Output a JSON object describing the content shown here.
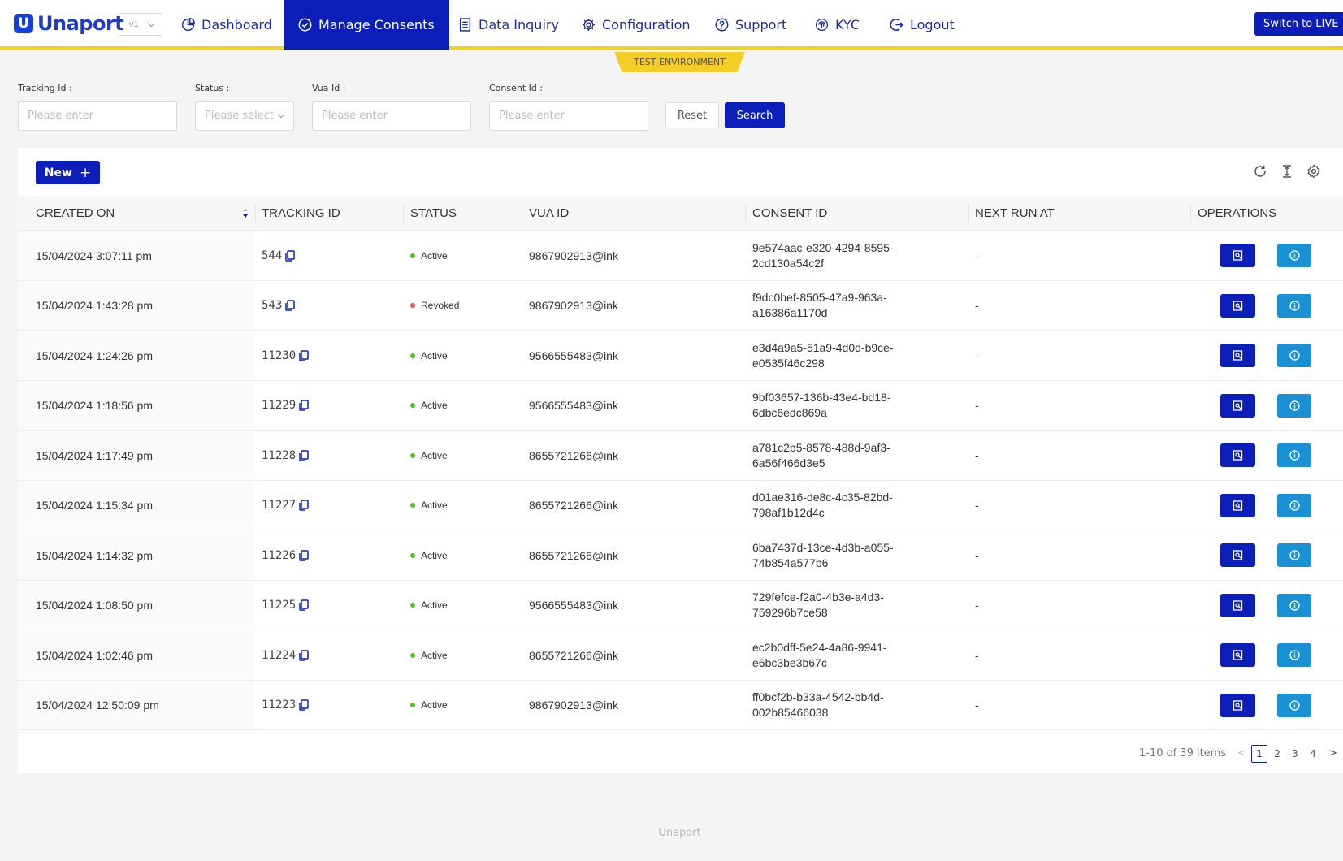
{
  "app": {
    "logo_letter": "U",
    "logo_text": "Unaport",
    "version": "v1",
    "env_label": "TEST ENVIRONMENT",
    "switch_label": "Switch to LIVE",
    "footer": "Unaport"
  },
  "nav": {
    "dashboard": "Dashboard",
    "manage_consents": "Manage Consents",
    "data_inquiry": "Data Inquiry",
    "configuration": "Configuration",
    "support": "Support",
    "kyc": "KYC",
    "logout": "Logout"
  },
  "filters": {
    "tracking_label": "Tracking Id :",
    "tracking_placeholder": "Please enter",
    "status_label": "Status :",
    "status_placeholder": "Please select",
    "vua_label": "Vua Id :",
    "vua_placeholder": "Please enter",
    "consent_label": "Consent Id :",
    "consent_placeholder": "Please enter",
    "reset": "Reset",
    "search": "Search"
  },
  "toolbar": {
    "new_label": "New",
    "new_icon": "+"
  },
  "table": {
    "headers": {
      "created_on": "CREATED ON",
      "tracking_id": "TRACKING ID",
      "status": "STATUS",
      "vua_id": "VUA ID",
      "consent_id": "CONSENT ID",
      "next_run_at": "NEXT RUN AT",
      "operations": "OPERATIONS"
    },
    "rows": [
      {
        "created": "15/04/2024 3:07:11 pm",
        "tracking": "544",
        "status": "Active",
        "vua": "9867902913@ink",
        "consent1": "9e574aac-e320-4294-8595-",
        "consent2": "2cd130a54c2f",
        "next": "-"
      },
      {
        "created": "15/04/2024 1:43:28 pm",
        "tracking": "543",
        "status": "Revoked",
        "vua": "9867902913@ink",
        "consent1": "f9dc0bef-8505-47a9-963a-",
        "consent2": "a16386a1170d",
        "next": "-"
      },
      {
        "created": "15/04/2024 1:24:26 pm",
        "tracking": "11230",
        "status": "Active",
        "vua": "9566555483@ink",
        "consent1": "e3d4a9a5-51a9-4d0d-b9ce-",
        "consent2": "e0535f46c298",
        "next": "-"
      },
      {
        "created": "15/04/2024 1:18:56 pm",
        "tracking": "11229",
        "status": "Active",
        "vua": "9566555483@ink",
        "consent1": "9bf03657-136b-43e4-bd18-",
        "consent2": "6dbc6edc869a",
        "next": "-"
      },
      {
        "created": "15/04/2024 1:17:49 pm",
        "tracking": "11228",
        "status": "Active",
        "vua": "8655721266@ink",
        "consent1": "a781c2b5-8578-488d-9af3-",
        "consent2": "6a56f466d3e5",
        "next": "-"
      },
      {
        "created": "15/04/2024 1:15:34 pm",
        "tracking": "11227",
        "status": "Active",
        "vua": "8655721266@ink",
        "consent1": "d01ae316-de8c-4c35-82bd-",
        "consent2": "798af1b12d4c",
        "next": "-"
      },
      {
        "created": "15/04/2024 1:14:32 pm",
        "tracking": "11226",
        "status": "Active",
        "vua": "8655721266@ink",
        "consent1": "6ba7437d-13ce-4d3b-a055-",
        "consent2": "74b854a577b6",
        "next": "-"
      },
      {
        "created": "15/04/2024 1:08:50 pm",
        "tracking": "11225",
        "status": "Active",
        "vua": "9566555483@ink",
        "consent1": "729fefce-f2a0-4b3e-a4d3-",
        "consent2": "759296b7ce58",
        "next": "-"
      },
      {
        "created": "15/04/2024 1:02:46 pm",
        "tracking": "11224",
        "status": "Active",
        "vua": "8655721266@ink",
        "consent1": "ec2b0dff-5e24-4a86-9941-",
        "consent2": "e6bc3be3b67c",
        "next": "-"
      },
      {
        "created": "15/04/2024 12:50:09 pm",
        "tracking": "11223",
        "status": "Active",
        "vua": "9867902913@ink",
        "consent1": "ff0bcf2b-b33a-4542-bb4d-",
        "consent2": "002b85466038",
        "next": "-"
      }
    ]
  },
  "pagination": {
    "total": "1-10 of 39 items",
    "pages": [
      "1",
      "2",
      "3",
      "4"
    ],
    "prev": "<",
    "next": ">"
  },
  "colors": {
    "primary": "#0b1fb8",
    "accent_yellow": "#f5cd27",
    "info_blue": "#1991d4",
    "active_dot": "#52c41a",
    "revoked_dot": "#ff4d4f"
  }
}
